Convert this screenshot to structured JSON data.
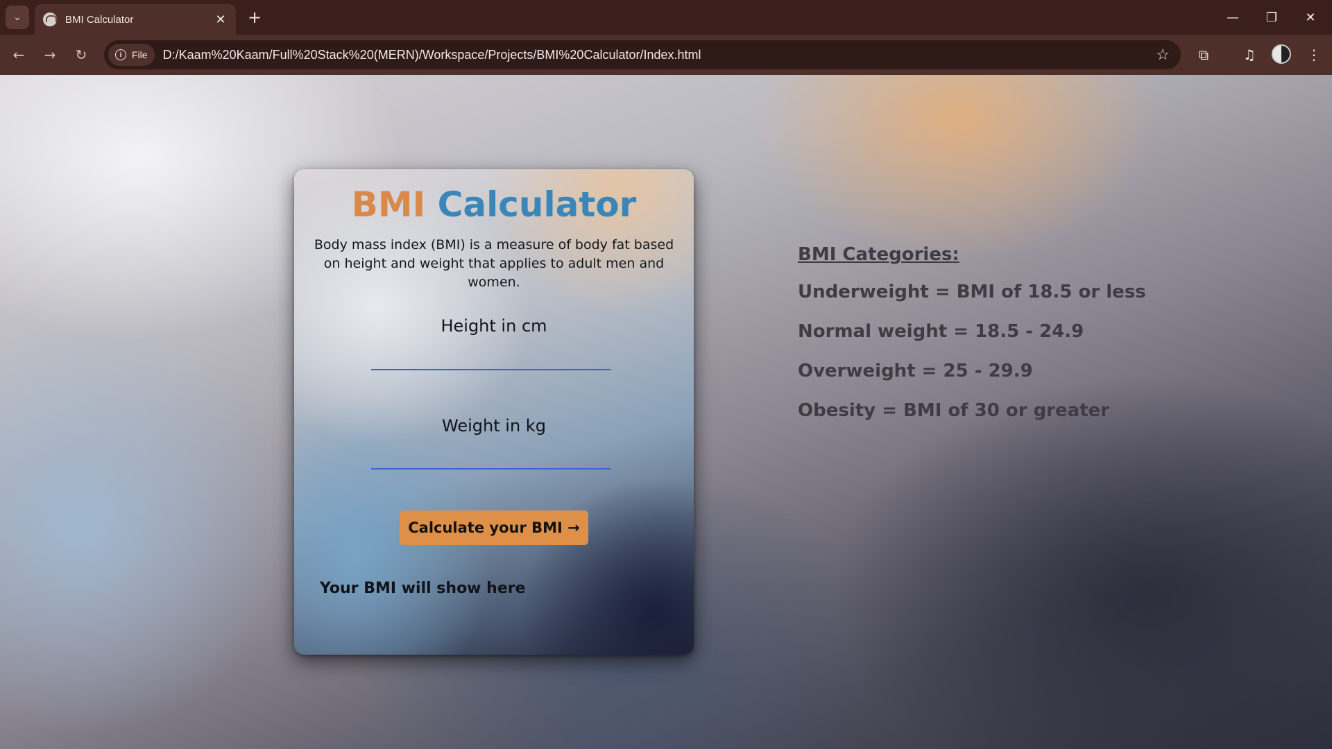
{
  "browser": {
    "tab_title": "BMI Calculator",
    "close_glyph": "✕",
    "new_tab_glyph": "+",
    "window_controls": {
      "minimize": "—",
      "restore": "❐",
      "close": "✕"
    },
    "nav": {
      "back": "←",
      "forward": "→",
      "reload": "↻"
    },
    "file_chip_label": "File",
    "url": "D:/Kaam%20Kaam/Full%20Stack%20(MERN)/Workspace/Projects/BMI%20Calculator/Index.html",
    "icons": [
      "tab-search-icon",
      "favicon-icon",
      "info-icon",
      "star-icon",
      "extensions-icon",
      "media-controls-icon",
      "avatar",
      "menu-icon"
    ]
  },
  "card": {
    "title_part1": "BMI",
    "title_part2": "Calculator",
    "description": "Body mass index (BMI) is a measure of body fat based on height and weight that applies to adult men and women.",
    "height_label": "Height in cm",
    "weight_label": "Weight in kg",
    "height_value": "",
    "weight_value": "",
    "button_label": "Calculate your BMI →",
    "result_text": "Your BMI will show here"
  },
  "categories": {
    "heading": "BMI Categories:",
    "items": [
      "Underweight = BMI of 18.5 or less",
      "Normal weight = 18.5 - 24.9",
      "Overweight = 25 - 29.9",
      "Obesity = BMI of 30 or greater"
    ]
  },
  "colors": {
    "title_bmi": "#d9894a",
    "title_calculator": "#3a86b8",
    "button": "#de8f48",
    "input_underline": "#3d63d6"
  }
}
